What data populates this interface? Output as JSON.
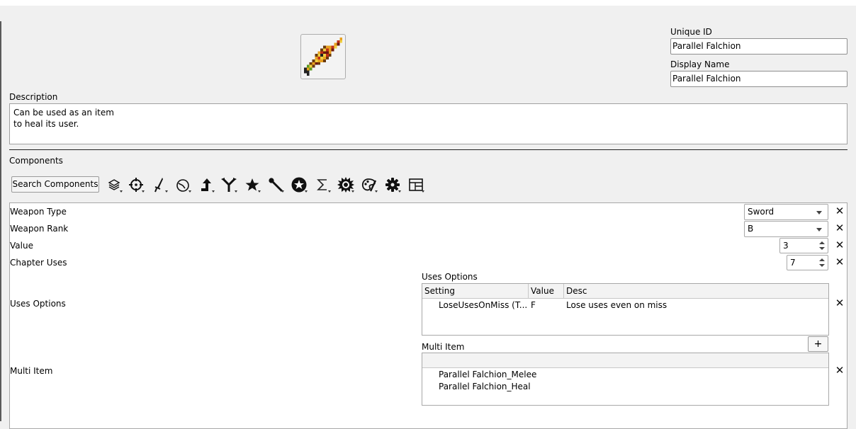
{
  "header": {
    "item_icon": "falchion-sprite-icon",
    "unique_id_label": "Unique ID",
    "unique_id_value": "Parallel Falchion",
    "display_name_label": "Display Name",
    "display_name_value": "Parallel Falchion"
  },
  "description": {
    "label": "Description",
    "line1": "Can be used as an item",
    "line2": "to heal its user."
  },
  "components": {
    "label": "Components",
    "search_button": "Search Components",
    "toolbar_icons": [
      "layers-icon",
      "target-icon",
      "sword-icon",
      "clock-icon",
      "arrow-up-icon",
      "branch-icon",
      "star-icon",
      "staff-icon",
      "star-circle-icon",
      "sigma-icon",
      "burst-icon",
      "palette-icon",
      "gear-icon",
      "layout-icon"
    ]
  },
  "rows": {
    "weapon_type": {
      "label": "Weapon Type",
      "value": "Sword"
    },
    "weapon_rank": {
      "label": "Weapon Rank",
      "value": "B"
    },
    "value": {
      "label": "Value",
      "value": "3"
    },
    "chapter_uses": {
      "label": "Chapter Uses",
      "value": "7"
    },
    "uses_options": {
      "label": "Uses Options",
      "title": "Uses Options",
      "columns": [
        "Setting",
        "Value",
        "Desc"
      ],
      "rows": [
        {
          "setting": "LoseUsesOnMiss (T...",
          "value": "F",
          "desc": "Lose uses even on miss"
        }
      ]
    },
    "multi_item": {
      "label": "Multi Item",
      "title": "Multi Item",
      "add_label": "+",
      "items": [
        "Parallel Falchion_Melee",
        "Parallel Falchion_Heal"
      ]
    }
  },
  "remove_glyph": "✕"
}
